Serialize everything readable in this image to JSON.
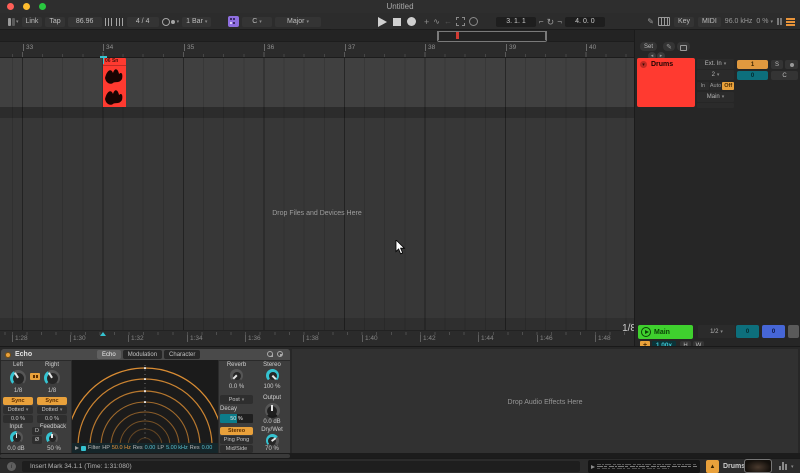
{
  "window": {
    "title": "Untitled"
  },
  "toolbar": {
    "link": "Link",
    "tap": "Tap",
    "tempo": "86.96",
    "time_sig": "4 / 4",
    "quantize": "1 Bar",
    "key_root": "C",
    "key_scale": "Major",
    "position": "34. 1. 1",
    "loop_start": "3. 1. 1",
    "loop_length": "4. 0. 0",
    "key": "Key",
    "midi": "MIDI",
    "sample_rate": "96.0 kHz",
    "cpu": "0 %"
  },
  "overview": {
    "set": "Set"
  },
  "ruler": {
    "bars": [
      "33",
      "34",
      "35",
      "36",
      "37",
      "38",
      "39",
      "40"
    ]
  },
  "arrangement": {
    "clip_name": "06 Sn",
    "drop_hint": "Drop Files and Devices Here",
    "times": [
      "1:28",
      "1:30",
      "1:32",
      "1:34",
      "1:36",
      "1:38",
      "1:40",
      "1:42",
      "1:44",
      "1:46",
      "1:48"
    ],
    "grid": "1/8"
  },
  "drums_track": {
    "name": "Drums",
    "input_type": "Ext. In",
    "input_channel": "2",
    "monitor": [
      "In",
      "Auto",
      "Off"
    ],
    "output": "Main",
    "activator": "1",
    "solo": "S",
    "meter": "0",
    "crossfade": "C"
  },
  "main_track": {
    "name": "Main",
    "lane_value": "1/2",
    "cue_level": "0",
    "volume": "0",
    "speed": "1.00x",
    "opt_height": "H",
    "opt_width": "W"
  },
  "echo": {
    "title": "Echo",
    "tabs": [
      "Echo",
      "Modulation",
      "Character"
    ],
    "left": {
      "label": "Left",
      "time": "1/8",
      "sync": "Sync",
      "division": "Dotted",
      "offset": "0.0 %"
    },
    "right": {
      "label": "Right",
      "time": "1/8",
      "sync": "Sync",
      "division": "Dotted",
      "offset": "0.0 %"
    },
    "input": {
      "label": "Input",
      "value": "0.0 dB"
    },
    "feedback": {
      "label": "Feedback",
      "value": "50 %"
    },
    "drift": "D",
    "phase": "Ø",
    "reverb": {
      "label": "Reverb",
      "value": "0.0 %",
      "position": "Post"
    },
    "stereo": {
      "label": "Stereo",
      "value": "100 %"
    },
    "decay": {
      "label": "Decay",
      "value": "50 %"
    },
    "output": {
      "label": "Output",
      "value": "0.0 dB"
    },
    "modes": [
      "Stereo",
      "Ping Pong",
      "Mid/Side"
    ],
    "drywet": {
      "label": "Dry/Wet",
      "value": "70 %"
    },
    "filter": {
      "label": "Filter",
      "hp": "HP",
      "hp_value": "50.0 Hz",
      "res": "Res",
      "res_hp": "0.00",
      "lp": "LP",
      "lp_value": "5.00 kHz",
      "res_lp": "0.00"
    }
  },
  "device_area": {
    "drop_hint": "Drop Audio Effects Here"
  },
  "status": {
    "message": "Insert Mark 34.1.1 (Time: 1:31:080)",
    "preview_track": "Drums"
  },
  "icons": {
    "traffic_lights": "css-circles",
    "follow": "css-bars",
    "nudge": "css-bars",
    "metronome": "circle-dot",
    "scale_awareness": "purple-grid",
    "play": "css-triangle",
    "stop": "css-square",
    "record": "css-circle",
    "overdub": "+",
    "automation_arm": "∿",
    "reenable_automation": "←",
    "capture_midi": "dashed-square",
    "session_record": "○",
    "punch_in": "⌐",
    "loop": "↻",
    "punch_out": "¬",
    "draw": "✎",
    "computer_midi_keyboard": "css-keys",
    "cpu_meter": "css-bars",
    "overload": "orange-bars",
    "lock": "css-lock",
    "fold": "▾",
    "hot_swap": "▲",
    "info": "i",
    "preview_play": "css-triangle"
  },
  "colors": {
    "accent_red": "#ff3a30",
    "amber": "#e9a13b",
    "cyan": "#35c3d1",
    "green": "#3fd12e",
    "blue": "#4666d6",
    "teal": "#0d6f7c",
    "purple": "#8f6fe0",
    "viz_orange": "#d98c33"
  }
}
